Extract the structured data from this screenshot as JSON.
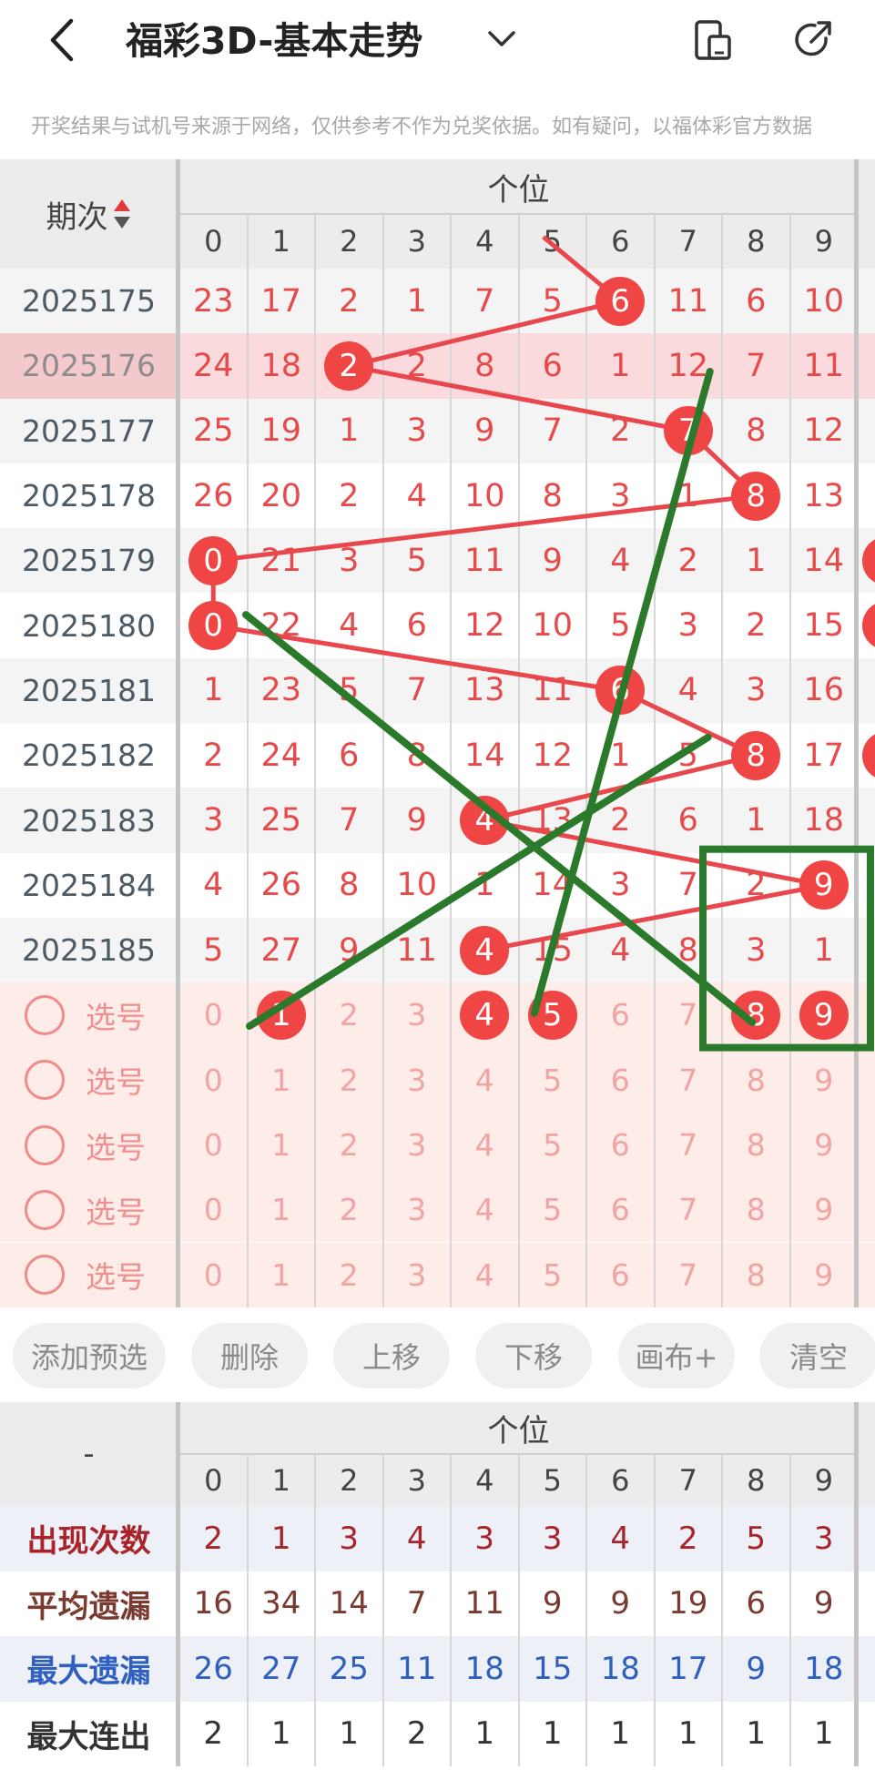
{
  "header": {
    "title": "福彩3D-基本走势"
  },
  "notice": "开奖结果与试机号来源于网络，仅供参考不作为兑奖依据。如有疑问，以福体彩官方数据",
  "grid": {
    "group_label": "个位",
    "period_header": "期次",
    "digits": [
      "0",
      "1",
      "2",
      "3",
      "4",
      "5",
      "6",
      "7",
      "8",
      "9"
    ],
    "rows": [
      {
        "period": "2025175",
        "values": [
          "23",
          "17",
          "2",
          "1",
          "7",
          "5",
          "6",
          "11",
          "6",
          "10"
        ],
        "hit": 6,
        "extra": false
      },
      {
        "period": "2025176",
        "values": [
          "24",
          "18",
          "2",
          "2",
          "8",
          "6",
          "1",
          "12",
          "7",
          "11"
        ],
        "hit": 2,
        "extra": false
      },
      {
        "period": "2025177",
        "values": [
          "25",
          "19",
          "1",
          "3",
          "9",
          "7",
          "2",
          "7",
          "8",
          "12"
        ],
        "hit": 7,
        "extra": false
      },
      {
        "period": "2025178",
        "values": [
          "26",
          "20",
          "2",
          "4",
          "10",
          "8",
          "3",
          "1",
          "8",
          "13"
        ],
        "hit": 8,
        "extra": false
      },
      {
        "period": "2025179",
        "values": [
          "0",
          "21",
          "3",
          "5",
          "11",
          "9",
          "4",
          "2",
          "1",
          "14"
        ],
        "hit": 0,
        "extra": true
      },
      {
        "period": "2025180",
        "values": [
          "0",
          "22",
          "4",
          "6",
          "12",
          "10",
          "5",
          "3",
          "2",
          "15"
        ],
        "hit": 0,
        "extra": true
      },
      {
        "period": "2025181",
        "values": [
          "1",
          "23",
          "5",
          "7",
          "13",
          "11",
          "6",
          "4",
          "3",
          "16"
        ],
        "hit": 6,
        "extra": false
      },
      {
        "period": "2025182",
        "values": [
          "2",
          "24",
          "6",
          "8",
          "14",
          "12",
          "1",
          "5",
          "8",
          "17"
        ],
        "hit": 8,
        "extra": true
      },
      {
        "period": "2025183",
        "values": [
          "3",
          "25",
          "7",
          "9",
          "4",
          "13",
          "2",
          "6",
          "1",
          "18"
        ],
        "hit": 4,
        "extra": false
      },
      {
        "period": "2025184",
        "values": [
          "4",
          "26",
          "8",
          "10",
          "1",
          "14",
          "3",
          "7",
          "2",
          "9"
        ],
        "hit": 9,
        "extra": false
      },
      {
        "period": "2025185",
        "values": [
          "5",
          "27",
          "9",
          "11",
          "4",
          "15",
          "4",
          "8",
          "3",
          "1"
        ],
        "hit": 4,
        "extra": false
      }
    ],
    "pick_label": "选号",
    "pick_rows": [
      {
        "selected": [
          1,
          4,
          5,
          8,
          9
        ]
      },
      {
        "selected": []
      },
      {
        "selected": []
      },
      {
        "selected": []
      },
      {
        "selected": []
      }
    ]
  },
  "buttons": [
    "添加预选",
    "删除",
    "上移",
    "下移",
    "画布+",
    "清空"
  ],
  "stats": {
    "group_label": "个位",
    "corner": "-",
    "digits": [
      "0",
      "1",
      "2",
      "3",
      "4",
      "5",
      "6",
      "7",
      "8",
      "9"
    ],
    "rows": [
      {
        "label": "出现次数",
        "values": [
          "2",
          "1",
          "3",
          "4",
          "3",
          "3",
          "4",
          "2",
          "5",
          "3"
        ],
        "color": "#a8232a"
      },
      {
        "label": "平均遗漏",
        "values": [
          "16",
          "34",
          "14",
          "7",
          "11",
          "9",
          "9",
          "19",
          "6",
          "9"
        ],
        "color": "#7a3a30"
      },
      {
        "label": "最大遗漏",
        "values": [
          "26",
          "27",
          "25",
          "11",
          "18",
          "15",
          "18",
          "17",
          "9",
          "18"
        ],
        "color": "#2f5fbf"
      },
      {
        "label": "最大连出",
        "values": [
          "2",
          "1",
          "1",
          "2",
          "1",
          "1",
          "1",
          "1",
          "1",
          "1"
        ],
        "color": "#333333"
      }
    ]
  },
  "colors": {
    "accent": "#f04545",
    "trend_line": "#e8474d",
    "annotation": "#2b7a2b",
    "highlight_row": "#fadadd",
    "pick_bg": "#fdece8"
  }
}
